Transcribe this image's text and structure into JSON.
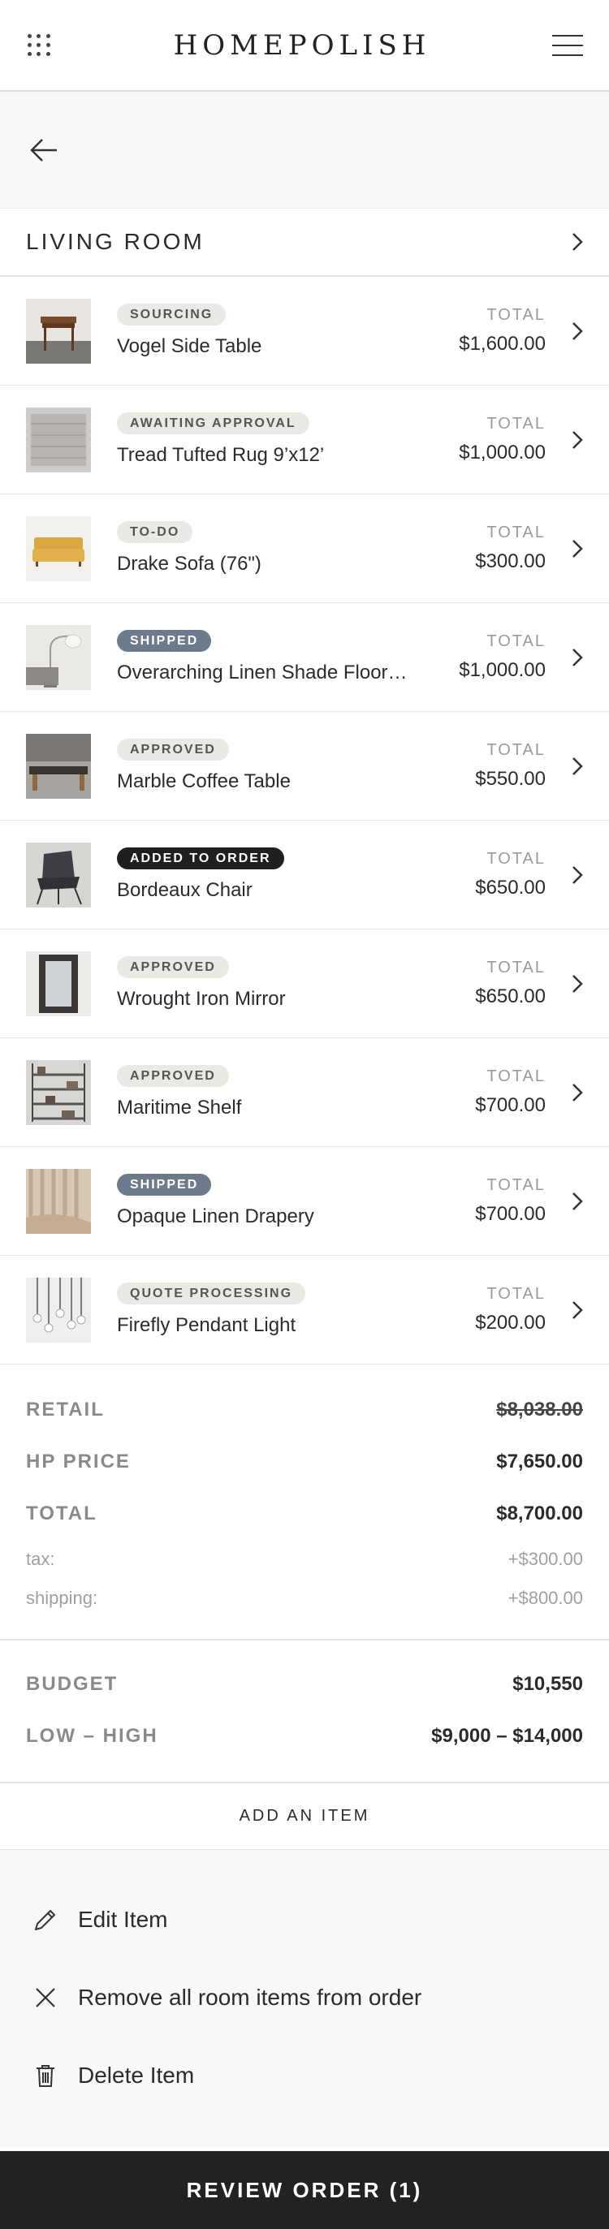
{
  "header": {
    "brand": "HOMEPOLISH"
  },
  "room": {
    "title": "LIVING ROOM"
  },
  "items": [
    {
      "badge": "SOURCING",
      "badge_style": "default",
      "name": "Vogel Side Table",
      "total_label": "TOTAL",
      "price": "$1,600.00",
      "thumb_icon": "side-table-image"
    },
    {
      "badge": "AWAITING APPROVAL",
      "badge_style": "default",
      "name": "Tread Tufted Rug 9’x12’",
      "total_label": "TOTAL",
      "price": "$1,000.00",
      "thumb_icon": "rug-image"
    },
    {
      "badge": "TO-DO",
      "badge_style": "default",
      "name": "Drake Sofa (76\")",
      "total_label": "TOTAL",
      "price": "$300.00",
      "thumb_icon": "sofa-image"
    },
    {
      "badge": "SHIPPED",
      "badge_style": "shipped",
      "name": "Overarching Linen Shade Floor…",
      "total_label": "TOTAL",
      "price": "$1,000.00",
      "thumb_icon": "floor-lamp-image"
    },
    {
      "badge": "APPROVED",
      "badge_style": "default",
      "name": "Marble Coffee Table",
      "total_label": "TOTAL",
      "price": "$550.00",
      "thumb_icon": "coffee-table-image"
    },
    {
      "badge": "ADDED TO ORDER",
      "badge_style": "added",
      "name": "Bordeaux Chair",
      "total_label": "TOTAL",
      "price": "$650.00",
      "thumb_icon": "chair-image"
    },
    {
      "badge": "APPROVED",
      "badge_style": "default",
      "name": "Wrought Iron Mirror",
      "total_label": "TOTAL",
      "price": "$650.00",
      "thumb_icon": "mirror-image"
    },
    {
      "badge": "APPROVED",
      "badge_style": "default",
      "name": "Maritime Shelf",
      "total_label": "TOTAL",
      "price": "$700.00",
      "thumb_icon": "shelf-image"
    },
    {
      "badge": "SHIPPED",
      "badge_style": "shipped",
      "name": "Opaque Linen Drapery",
      "total_label": "TOTAL",
      "price": "$700.00",
      "thumb_icon": "drapery-image"
    },
    {
      "badge": "QUOTE PROCESSING",
      "badge_style": "default",
      "name": "Firefly Pendant Light",
      "total_label": "TOTAL",
      "price": "$200.00",
      "thumb_icon": "pendant-light-image"
    }
  ],
  "summary": {
    "retail_label": "RETAIL",
    "retail_value": "$8,038.00",
    "hp_label": "HP PRICE",
    "hp_value": "$7,650.00",
    "total_label": "TOTAL",
    "total_value": "$8,700.00",
    "tax_label": "tax:",
    "tax_value": "+$300.00",
    "shipping_label": "shipping:",
    "shipping_value": "+$800.00"
  },
  "budget": {
    "budget_label": "BUDGET",
    "budget_value": "$10,550",
    "range_label": "LOW – HIGH",
    "range_value": "$9,000 – $14,000"
  },
  "add_item_label": "ADD AN ITEM",
  "actions": {
    "edit": "Edit Item",
    "remove_all": "Remove all room items from order",
    "delete": "Delete Item"
  },
  "review_button": "REVIEW ORDER (1)",
  "colors": {
    "badge_default": "#ebe9e4",
    "badge_shipped": "#6d7a8c",
    "badge_added": "#1f1f1f",
    "review_bg": "#222222"
  }
}
